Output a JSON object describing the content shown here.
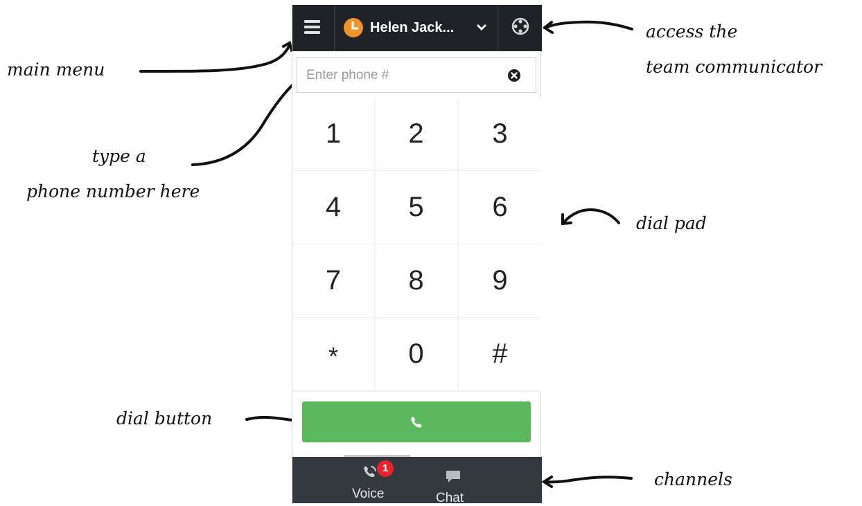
{
  "header": {
    "user_name": "Helen Jack...",
    "menu_icon": "hamburger-icon",
    "status_icon": "clock-status-icon",
    "dropdown_icon": "chevron-down-icon",
    "team_icon": "team-communicator-icon",
    "status_color": "#f0932b"
  },
  "phone": {
    "placeholder": "Enter phone #",
    "value": "",
    "clear_icon": "clear-circle-icon"
  },
  "dialpad": {
    "keys": [
      "1",
      "2",
      "3",
      "4",
      "5",
      "6",
      "7",
      "8",
      "9",
      "*",
      "0",
      "#"
    ]
  },
  "dial_button": {
    "icon": "phone-icon",
    "color": "#5cb85c"
  },
  "channels": {
    "voice": {
      "label": "Voice",
      "badge": "1",
      "icon": "phone-ringing-icon"
    },
    "chat": {
      "label": "Chat",
      "icon": "chat-bubble-icon"
    }
  },
  "annotations": {
    "main_menu": "main menu",
    "team_line1": "access the",
    "team_line2": "team communicator",
    "phone_line1": "type a",
    "phone_line2": "phone number here",
    "dial_pad": "dial pad",
    "dial_button": "dial button",
    "channels": "channels"
  }
}
